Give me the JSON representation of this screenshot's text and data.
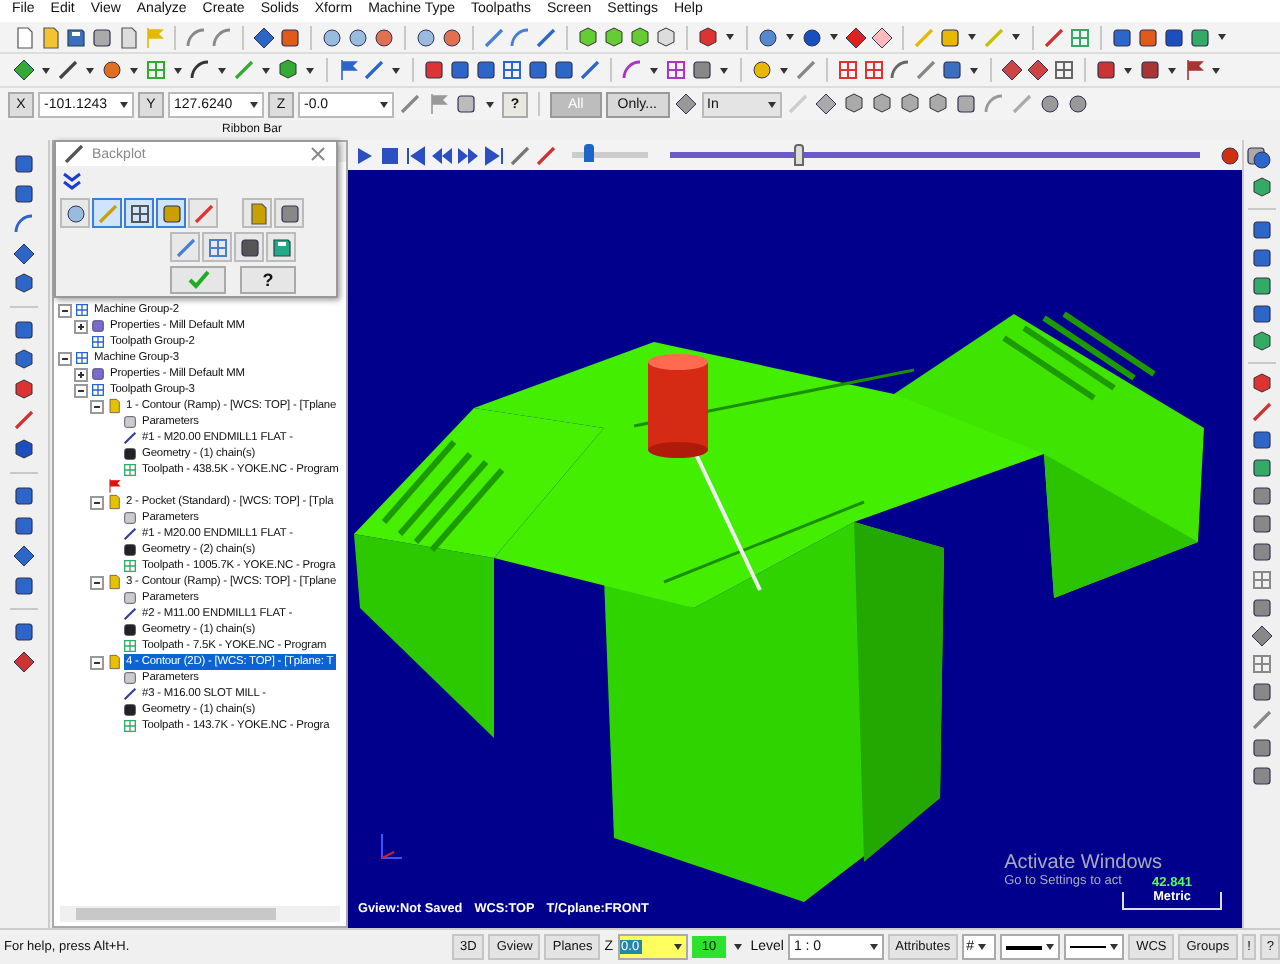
{
  "menu_bar": [
    "File",
    "Edit",
    "View",
    "Analyze",
    "Create",
    "Solids",
    "Xform",
    "Machine Type",
    "Toolpaths",
    "Screen",
    "Settings",
    "Help"
  ],
  "coordinate_bar": {
    "fields": [
      {
        "label": "X",
        "value": "-101.1243"
      },
      {
        "label": "Y",
        "value": "127.6240"
      },
      {
        "label": "Z",
        "value": "-0.0"
      }
    ],
    "all_button": {
      "label": "All",
      "disabled": true
    },
    "only_button": {
      "label": "Only...",
      "disabled": false
    },
    "mode_dropdown": {
      "value": "In"
    },
    "help_label": "?"
  },
  "ribbon_bar_label": "Ribbon Bar",
  "backplot": {
    "title": "Backplot",
    "tool_buttons": [
      {
        "selected": false
      },
      {
        "selected": true
      },
      {
        "selected": true
      },
      {
        "selected": true
      },
      {
        "selected": false
      },
      {
        "selected": false
      },
      {
        "selected": false
      }
    ],
    "help_label": "?"
  },
  "tree": [
    {
      "kind": "machine_group",
      "label": "Machine Group-2",
      "expanded": true,
      "selected": false,
      "children": [
        {
          "kind": "properties",
          "label": "Properties - Mill Default MM",
          "expanded": false,
          "selected": false
        },
        {
          "kind": "toolpath_group",
          "label": "Toolpath Group-2",
          "selected": false
        }
      ]
    },
    {
      "kind": "machine_group",
      "label": "Machine Group-3",
      "expanded": true,
      "selected": false,
      "children": [
        {
          "kind": "properties",
          "label": "Properties - Mill Default MM",
          "expanded": false,
          "selected": false
        },
        {
          "kind": "toolpath_group",
          "label": "Toolpath Group-3",
          "expanded": true,
          "selected": false,
          "children": [
            {
              "kind": "operation",
              "label": "1 - Contour (Ramp) - [WCS: TOP] - [Tplane",
              "expanded": true,
              "selected": false,
              "children": [
                {
                  "kind": "parameters",
                  "label": "Parameters",
                  "selected": false
                },
                {
                  "kind": "tool",
                  "label": "#1 - M20.00 ENDMILL1 FLAT -",
                  "selected": false
                },
                {
                  "kind": "geometry",
                  "label": "Geometry - (1) chain(s)",
                  "selected": false
                },
                {
                  "kind": "toolpath",
                  "label": "Toolpath - 438.5K - YOKE.NC - Program",
                  "selected": false
                }
              ]
            },
            {
              "kind": "insert_marker",
              "selected": false
            },
            {
              "kind": "operation",
              "label": "2 - Pocket (Standard) - [WCS: TOP] - [Tpla",
              "expanded": true,
              "selected": false,
              "children": [
                {
                  "kind": "parameters",
                  "label": "Parameters",
                  "selected": false
                },
                {
                  "kind": "tool",
                  "label": "#1 - M20.00 ENDMILL1 FLAT -",
                  "selected": false
                },
                {
                  "kind": "geometry",
                  "label": "Geometry - (2) chain(s)",
                  "selected": false
                },
                {
                  "kind": "toolpath",
                  "label": "Toolpath - 1005.7K - YOKE.NC - Progra",
                  "selected": false
                }
              ]
            },
            {
              "kind": "operation",
              "label": "3 - Contour (Ramp) - [WCS: TOP] - [Tplane",
              "expanded": true,
              "selected": false,
              "children": [
                {
                  "kind": "parameters",
                  "label": "Parameters",
                  "selected": false
                },
                {
                  "kind": "tool",
                  "label": "#2 - M11.00 ENDMILL1 FLAT -",
                  "selected": false
                },
                {
                  "kind": "geometry",
                  "label": "Geometry - (1) chain(s)",
                  "selected": false
                },
                {
                  "kind": "toolpath",
                  "label": "Toolpath - 7.5K - YOKE.NC - Program",
                  "selected": false
                }
              ]
            },
            {
              "kind": "operation",
              "label": "4 - Contour (2D) - [WCS: TOP] - [Tplane: T",
              "expanded": true,
              "selected": true,
              "children": [
                {
                  "kind": "parameters",
                  "label": "Parameters",
                  "selected": false
                },
                {
                  "kind": "tool",
                  "label": "#3 - M16.00 SLOT MILL -",
                  "selected": false
                },
                {
                  "kind": "geometry",
                  "label": "Geometry - (1) chain(s)",
                  "selected": false
                },
                {
                  "kind": "toolpath",
                  "label": "Toolpath - 143.7K - YOKE.NC - Progra",
                  "selected": false
                }
              ]
            }
          ]
        }
      ]
    }
  ],
  "viewport": {
    "speed_slider": {
      "level": 0.2
    },
    "progress_slider": {
      "level": 0.24
    },
    "info": [
      "Gview:Not Saved",
      "WCS:TOP",
      "T/Cplane:FRONT"
    ],
    "watermark_title": "Activate Windows",
    "watermark_text": "Go to Settings to act",
    "scale": {
      "value": "42.841",
      "unit": "Metric"
    }
  },
  "status_bar": {
    "help_text": "For help, press Alt+H.",
    "view_buttons": [
      "3D",
      "Gview",
      "Planes"
    ],
    "z_label": "Z",
    "z_value": "0.0",
    "color_value": "10",
    "level_label": "Level",
    "level_value": "1 : 0",
    "attributes_button": "Attributes",
    "point_style": "#",
    "wcs_button": "WCS",
    "groups_button": "Groups",
    "extra_buttons": [
      "!",
      "?"
    ]
  }
}
